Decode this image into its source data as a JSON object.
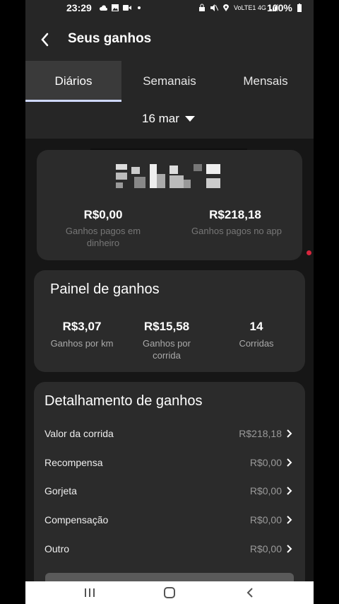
{
  "status_bar": {
    "time": "23:29",
    "network": "VoLTE1 4G",
    "battery": "100%"
  },
  "header": {
    "title": "Seus ganhos"
  },
  "tabs": [
    {
      "label": "Diários",
      "active": true
    },
    {
      "label": "Semanais"
    },
    {
      "label": "Mensais"
    }
  ],
  "date_selector": {
    "value": "16 mar"
  },
  "summary": {
    "cash_value": "R$0,00",
    "cash_label": "Ganhos pagos em dinheiro",
    "app_value": "R$218,18",
    "app_label": "Ganhos pagos no app"
  },
  "panel": {
    "title": "Painel de ganhos",
    "stats": [
      {
        "value": "R$3,07",
        "label": "Ganhos por km"
      },
      {
        "value": "R$15,58",
        "label": "Ganhos por corrida"
      },
      {
        "value": "14",
        "label": "Corridas"
      }
    ]
  },
  "breakdown": {
    "title": "Detalhamento de ganhos",
    "rows": [
      {
        "label": "Valor da corrida",
        "value": "R$218,18"
      },
      {
        "label": "Recompensa",
        "value": "R$0,00"
      },
      {
        "label": "Gorjeta",
        "value": "R$0,00"
      },
      {
        "label": "Compensação",
        "value": "R$0,00"
      },
      {
        "label": "Outro",
        "value": "R$0,00"
      }
    ]
  },
  "colors": {
    "background": "#161616",
    "card": "#2b2b2b",
    "tab_indicator": "#cfd8ff",
    "notification_dot": "#d7263d"
  }
}
